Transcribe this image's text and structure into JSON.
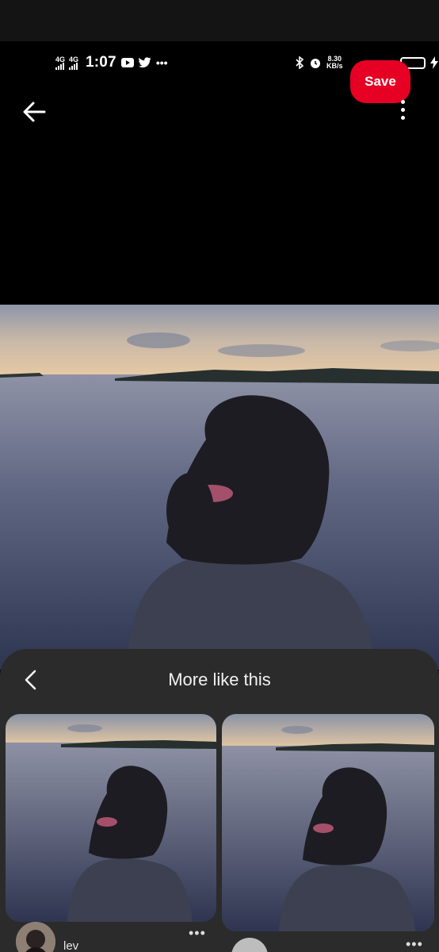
{
  "status_bar": {
    "network_1": "4G",
    "network_2": "4G",
    "time": "1:07",
    "speed_value": "8.30",
    "speed_unit": "KB/s",
    "icons": [
      "youtube-icon",
      "twitter-icon",
      "more-notifications-icon",
      "bluetooth-icon",
      "alarm-icon",
      "battery-icon",
      "charging-icon"
    ]
  },
  "header": {
    "save_label": "Save",
    "back_icon": "arrow-left-icon",
    "more_icon": "vertical-ellipsis-icon"
  },
  "sheet": {
    "title": "More like this",
    "back_icon": "chevron-left-icon",
    "cards": [
      {
        "username": "lev",
        "more_label": "•••"
      },
      {
        "username": "",
        "more_label": "•••"
      }
    ]
  },
  "colors": {
    "accent": "#e60023",
    "sheet_bg": "#2b2b2b",
    "background": "#000000"
  }
}
